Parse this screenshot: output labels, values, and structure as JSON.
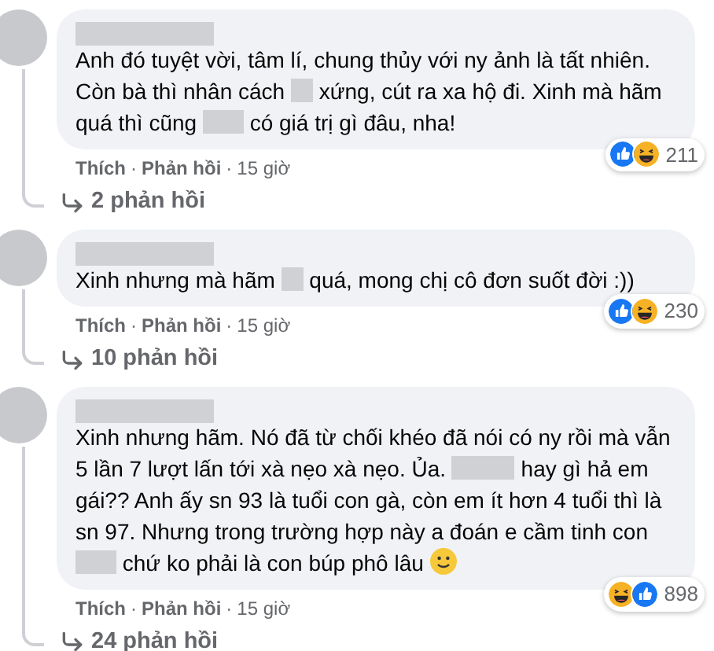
{
  "comments": [
    {
      "author": {
        "kind": "blurred"
      },
      "body": [
        {
          "kind": "text",
          "text": "Anh đó tuyệt vời, tâm lí, chung thủy với ny ảnh là tất nhiên. Còn bà thì nhân cách "
        },
        {
          "kind": "short"
        },
        {
          "kind": "text",
          "text": " xứng, cút ra xa hộ đi. Xinh mà hãm quá thì cũng "
        },
        {
          "kind": "medium"
        },
        {
          "kind": "text",
          "text": " có giá trị gì đâu, nha!"
        }
      ],
      "reactions": [
        {
          "kind": "like"
        },
        {
          "kind": "haha"
        }
      ],
      "reaction_count": "211",
      "like": "Thích",
      "separator": "·",
      "reply": "Phản hồi",
      "separator_2": "·",
      "time": "15 giờ",
      "replies": "2 phản hồi"
    },
    {
      "author": {
        "kind": "blurred"
      },
      "body": [
        {
          "kind": "text",
          "text": "Xinh nhưng mà hãm "
        },
        {
          "kind": "short"
        },
        {
          "kind": "text",
          "text": " quá, mong chị cô đơn suốt đời :))"
        }
      ],
      "reactions": [
        {
          "kind": "like"
        },
        {
          "kind": "haha"
        }
      ],
      "reaction_count": "230",
      "like": "Thích",
      "separator": "·",
      "reply": "Phản hồi",
      "separator_2": "·",
      "time": "15 giờ",
      "replies": "10 phản hồi"
    },
    {
      "author": {
        "kind": "blurred"
      },
      "body": [
        {
          "kind": "text",
          "text": "Xinh nhưng hãm. Nó đã từ chối khéo đã nói có ny rồi mà vẫn 5 lần 7 lượt lấn tới xà nẹo xà nẹo. Ủa. "
        },
        {
          "kind": "long"
        },
        {
          "kind": "text",
          "text": " hay gì hả em gái?? Anh ấy sn 93 là tuổi con gà, còn em ít hơn 4 tuổi thì là sn 97. Nhưng trong trường hợp này a đoán e cầm tinh con "
        },
        {
          "kind": "medium"
        },
        {
          "kind": "text",
          "text": " chứ ko phải là con búp phô lâu "
        },
        {
          "kind": "smile"
        }
      ],
      "reactions": [
        {
          "kind": "haha"
        },
        {
          "kind": "like"
        }
      ],
      "reaction_count": "898",
      "like": "Thích",
      "separator": "·",
      "reply": "Phản hồi",
      "separator_2": "·",
      "time": "15 giờ",
      "replies": "24 phản hồi"
    }
  ]
}
